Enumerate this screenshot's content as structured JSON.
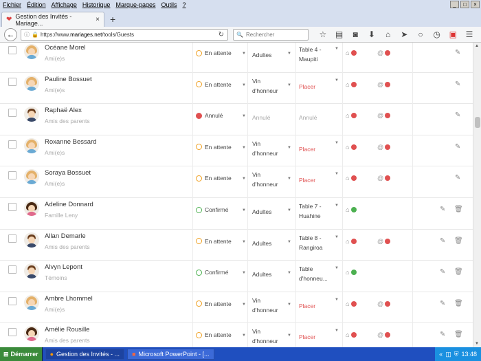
{
  "menubar": {
    "items": [
      "Fichier",
      "Édition",
      "Affichage",
      "Historique",
      "Marque-pages",
      "Outils",
      "?"
    ]
  },
  "window": {
    "controls": [
      "_",
      "□",
      "×"
    ]
  },
  "tab": {
    "title": "Gestion des Invités - Mariage...",
    "close": "×",
    "new": "+"
  },
  "nav": {
    "url_prefix": "https://www.",
    "url_host": "mariages.net",
    "url_path": "/tools/Guests",
    "search_placeholder": "Rechercher"
  },
  "guests": [
    {
      "name": "Océane Morel",
      "group": "Ami(e)s",
      "status": "En attente",
      "status_type": "wait",
      "menu": "Adultes",
      "table": "Table 4 - Maupiti",
      "table_type": "normal",
      "inv": "red",
      "at": true,
      "edit": true,
      "trash": false,
      "avatar": "f"
    },
    {
      "name": "Pauline Bossuet",
      "group": "Ami(e)s",
      "status": "En attente",
      "status_type": "wait",
      "menu": "Vin d'honneur",
      "table": "Placer",
      "table_type": "red",
      "inv": "red",
      "at": true,
      "edit": true,
      "trash": false,
      "avatar": "f"
    },
    {
      "name": "Raphaë Alex",
      "group": "Amis des parents",
      "status": "Annulé",
      "status_type": "no",
      "menu": "Annulé",
      "menu_grey": true,
      "table": "Annulé",
      "table_type": "grey",
      "inv": "red",
      "at": true,
      "edit": true,
      "trash": false,
      "avatar": "m"
    },
    {
      "name": "Roxanne Bessard",
      "group": "Ami(e)s",
      "status": "En attente",
      "status_type": "wait",
      "menu": "Vin d'honneur",
      "table": "Placer",
      "table_type": "red",
      "inv": "red",
      "at": true,
      "edit": true,
      "trash": false,
      "avatar": "f"
    },
    {
      "name": "Soraya Bossuet",
      "group": "Ami(e)s",
      "status": "En attente",
      "status_type": "wait",
      "menu": "Vin d'honneur",
      "table": "Placer",
      "table_type": "red",
      "inv": "red",
      "at": true,
      "edit": true,
      "trash": false,
      "avatar": "f"
    },
    {
      "name": "Adeline Donnard",
      "group": "Famille Leny",
      "status": "Confirmé",
      "status_type": "ok",
      "menu": "Adultes",
      "table": "Table 7 - Huahine",
      "table_type": "normal",
      "inv": "green",
      "at": false,
      "edit": true,
      "trash": true,
      "avatar": "f2"
    },
    {
      "name": "Allan Demarle",
      "group": "Amis des parents",
      "status": "En attente",
      "status_type": "wait",
      "menu": "Adultes",
      "table": "Table 8 - Rangiroa",
      "table_type": "normal",
      "inv": "red",
      "at": true,
      "edit": true,
      "trash": true,
      "avatar": "m"
    },
    {
      "name": "Alvyn Lepont",
      "group": "Témoins",
      "status": "Confirmé",
      "status_type": "ok",
      "menu": "Adultes",
      "table": "Table d'honneu...",
      "table_type": "normal",
      "inv": "green",
      "at": false,
      "edit": true,
      "trash": true,
      "avatar": "m"
    },
    {
      "name": "Ambre Lhommel",
      "group": "Ami(e)s",
      "status": "En attente",
      "status_type": "wait",
      "menu": "Vin d'honneur",
      "table": "Placer",
      "table_type": "red",
      "inv": "red",
      "at": true,
      "edit": true,
      "trash": true,
      "avatar": "f"
    },
    {
      "name": "Amélie Rousille",
      "group": "Amis des parents",
      "status": "En attente",
      "status_type": "wait",
      "menu": "Vin d'honneur",
      "table": "Placer",
      "table_type": "red",
      "inv": "red",
      "at": true,
      "edit": true,
      "trash": true,
      "avatar": "f2"
    }
  ],
  "taskbar": {
    "start": "Démarrer",
    "tasks": [
      "Gestion des Invités - ...",
      "Microsoft PowerPoint - [..."
    ],
    "clock": "13:48",
    "tray_arrow": "«"
  },
  "colors": {
    "wait": "#f0a020",
    "ok": "#4cb050",
    "no": "#e05050",
    "accent": "#e05050"
  }
}
